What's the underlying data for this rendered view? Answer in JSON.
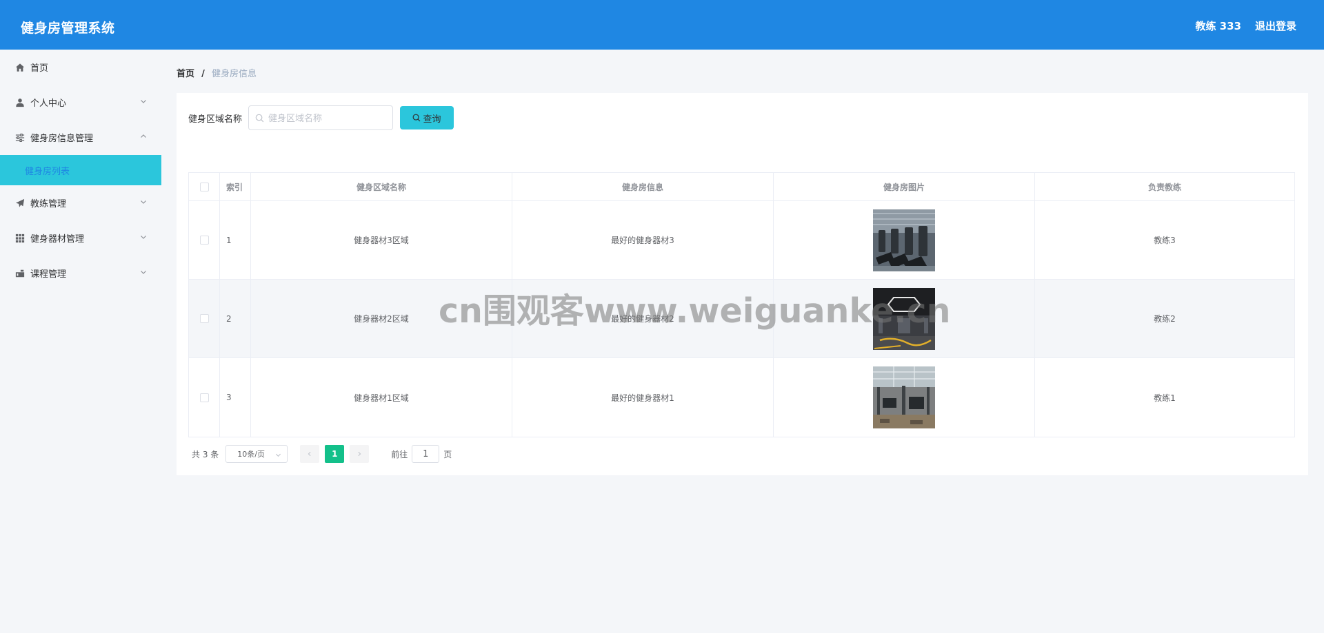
{
  "header": {
    "title": "健身房管理系统",
    "user": "教练 333",
    "logout": "退出登录"
  },
  "sidebar": {
    "items": [
      {
        "label": "首页",
        "icon": "home-icon",
        "expandable": false
      },
      {
        "label": "个人中心",
        "icon": "user-icon",
        "expandable": true,
        "expanded": false
      },
      {
        "label": "健身房信息管理",
        "icon": "sliders-icon",
        "expandable": true,
        "expanded": true
      },
      {
        "label": "教练管理",
        "icon": "send-icon",
        "expandable": true,
        "expanded": false
      },
      {
        "label": "健身器材管理",
        "icon": "grid-icon",
        "expandable": true,
        "expanded": false
      },
      {
        "label": "课程管理",
        "icon": "briefcase-icon",
        "expandable": true,
        "expanded": false
      }
    ],
    "subitems": [
      {
        "label": "健身房列表",
        "active": true
      }
    ]
  },
  "breadcrumb": {
    "home": "首页",
    "separator": "/",
    "current": "健身房信息"
  },
  "search": {
    "label": "健身区域名称",
    "placeholder": "健身区域名称",
    "value": "",
    "button": "查询"
  },
  "table": {
    "columns": [
      "索引",
      "健身区域名称",
      "健身房信息",
      "健身房图片",
      "负责教练"
    ],
    "rows": [
      {
        "index": "1",
        "name": "健身器材3区域",
        "info": "最好的健身器材3",
        "image": "gym-treadmills-photo",
        "coach": "教练3"
      },
      {
        "index": "2",
        "name": "健身器材2区域",
        "info": "最好的健身器材2",
        "image": "gym-hall-photo",
        "coach": "教练2"
      },
      {
        "index": "3",
        "name": "健身器材1区域",
        "info": "最好的健身器材1",
        "image": "gym-equipment-photo",
        "coach": "教练1"
      }
    ]
  },
  "pagination": {
    "total": "共 3 条",
    "page_size": "10条/页",
    "current_page": "1",
    "goto_label": "前往",
    "goto_value": "1",
    "page_unit": "页"
  },
  "watermark": "cn围观客www.weiguanke.cn",
  "colors": {
    "header_bg": "#1f87e3",
    "accent": "#2bc6dc",
    "active_page": "#13c08a",
    "page_bg": "#f4f6f9"
  }
}
